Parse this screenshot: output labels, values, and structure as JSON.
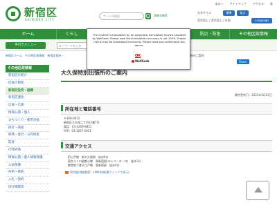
{
  "header": {
    "logo_jp": "新宿区",
    "logo_en": "SHINJUKU CITY",
    "search_placeholder": "サイト内検索",
    "adv_search": "詳細な検索",
    "toplinks": [
      "本文へ",
      "サイトマップ",
      "アクセス",
      "各"
    ],
    "size_label": "文字サイズ",
    "size_normal": "標準",
    "size_large": "拡大",
    "lang_links": "音声読上 / 音声読上 / 外国",
    "language_btn": "Language"
  },
  "nav": {
    "items": [
      "ホーム",
      "くらし",
      "",
      "",
      "防災・防犯",
      "その他区政情報"
    ]
  },
  "subbar": {
    "tebiki": "手引きメニュー",
    "input_placeholder": "キーワードを入力"
  },
  "breadcrumb": {
    "items": [
      "新宿区ホーム",
      "その他区政情報",
      "新宿区役所・"
    ],
    "current": "大久保特別出張所のご案内"
  },
  "share_label": "Share",
  "sidebar": {
    "head": "その他区政情報",
    "items": [
      "新宿区の紹介",
      "区長の部屋",
      "新宿区役所・組織",
      "新宿区議会",
      "広報・広聴",
      "情報公開・個人",
      "まちづくり・都市計画",
      "統計・調査",
      "財政・会計・公有財産",
      "監査",
      "行政評価",
      "情報公開・個人情報保護",
      "公益保護",
      "条例・規則",
      "入札・契約",
      "街灯機関等"
    ]
  },
  "main": {
    "title": "大久保特別出張所のご案内",
    "updated": "最終更新日：2022年5月22日",
    "section1": "所在地と電話番号",
    "info_lines": [
      "〒169-0072",
      "新宿区大久保二丁目12番7号",
      "電話：03-3209-8851",
      "FAX：03-3207-1831"
    ],
    "section2": "交通アクセス",
    "access_lines": [
      "JR山手線　新大久保駅　徒歩8分",
      "東京メトロ副都心線　東新宿駅(エレベーター口)　徒歩3分",
      "都営地下鉄大江戸線　東新宿駅　徒歩4分"
    ],
    "map_link": "案内図(地図検索：LINK別(新規ウィンドウ表示)"
  },
  "dialog": {
    "text": "The content is translated by an automatic translation service provided by WellSeek. Please note that translation accuracy is not 100%. Proper nouns may be translated incorrectly. Please read and understand the above.",
    "ok": "OK",
    "brand": "WellSeek"
  }
}
